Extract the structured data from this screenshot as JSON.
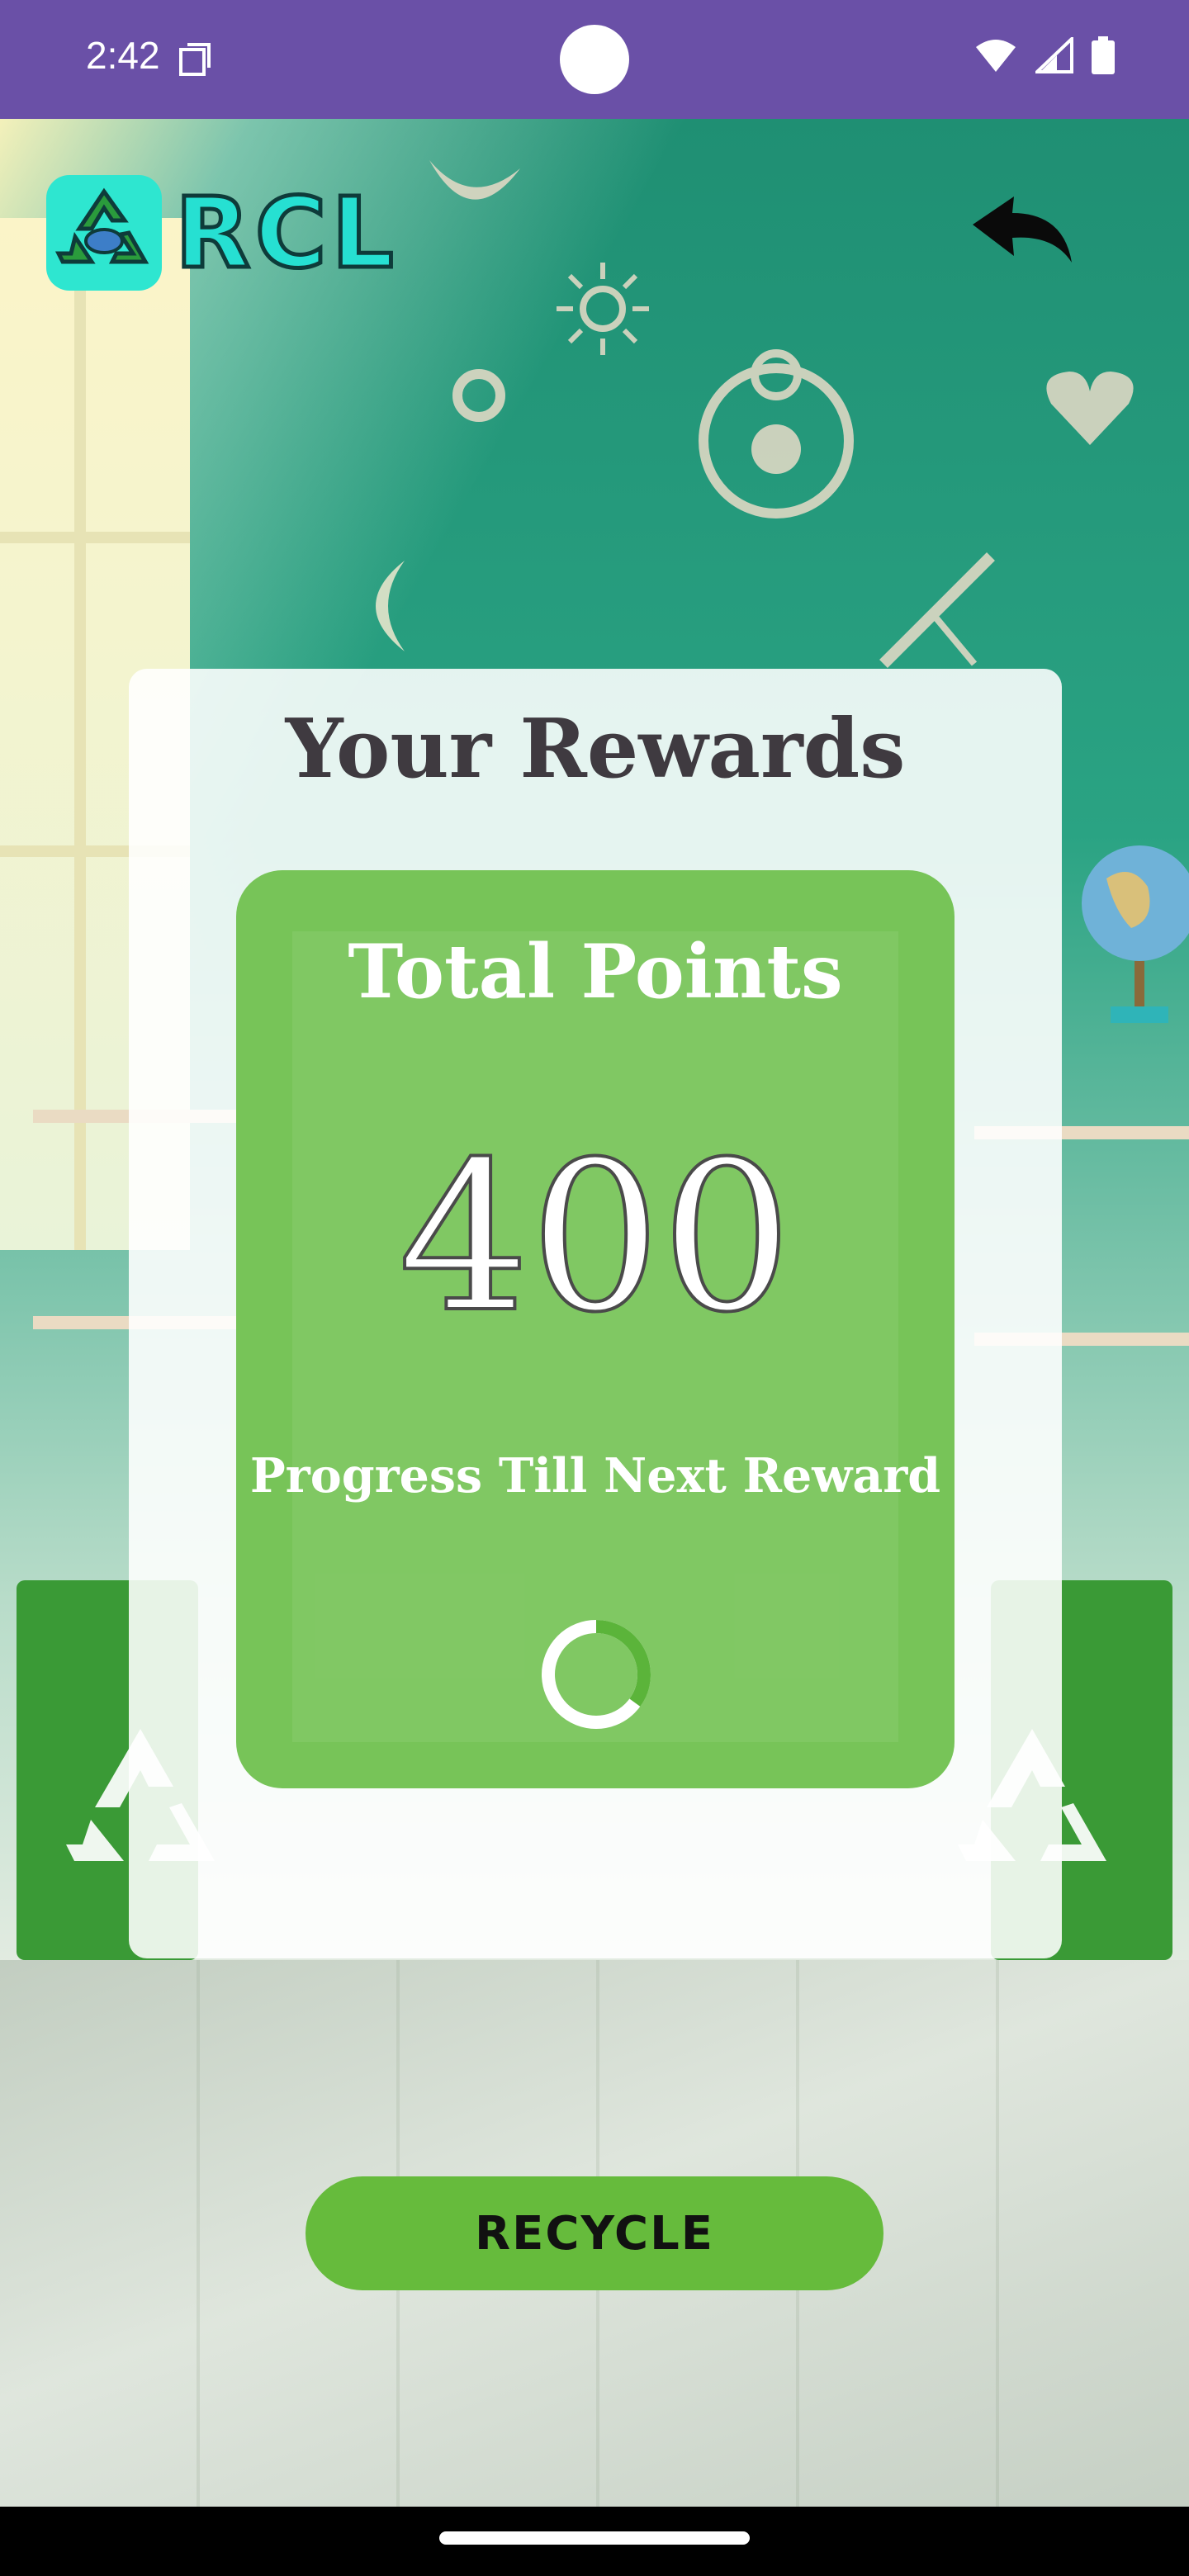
{
  "status_bar": {
    "time": "2:42",
    "icons": [
      "sim-card-icon",
      "wifi-icon",
      "signal-icon",
      "battery-icon"
    ]
  },
  "header": {
    "logo_text": "RCL",
    "back_icon": "back-arrow-icon"
  },
  "rewards": {
    "title": "Your Rewards",
    "points_label": "Total Points",
    "points_value": "400",
    "progress_label": "Progress Till Next Reward",
    "progress_fraction": 0.35
  },
  "actions": {
    "recycle_label": "RECYCLE"
  },
  "colors": {
    "status_bar": "#6a50a7",
    "card_green": "#77c458",
    "button_green": "#66bb3c",
    "logo_teal": "#26e0d2"
  }
}
